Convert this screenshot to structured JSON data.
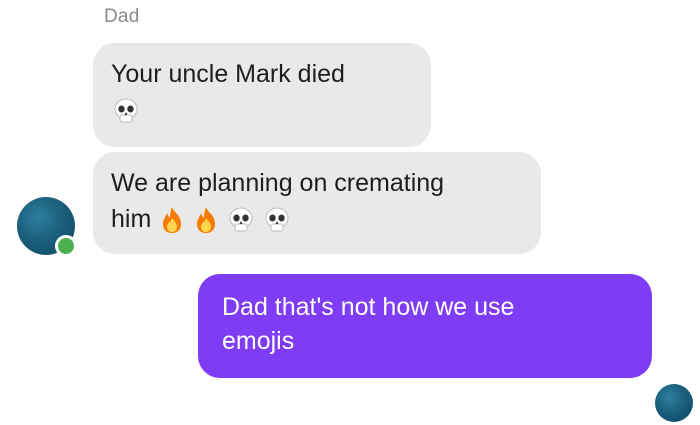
{
  "thread": {
    "sender_name": "Dad",
    "messages": [
      {
        "from": "Dad",
        "lines": [
          "Your uncle Mark died"
        ],
        "emojis": [
          "skull"
        ]
      },
      {
        "from": "Dad",
        "lines": [
          "We are planning on cremating",
          "him"
        ],
        "emojis": [
          "fire",
          "fire",
          "skull",
          "skull"
        ]
      },
      {
        "from": "me",
        "lines": [
          "Dad that's not how we use",
          "emojis"
        ]
      }
    ]
  },
  "colors": {
    "incoming_bubble": "#e9e9e9",
    "outgoing_bubble": "#7f3cf5",
    "avatar": "#1a5f7c",
    "online_dot": "#4caf50"
  }
}
